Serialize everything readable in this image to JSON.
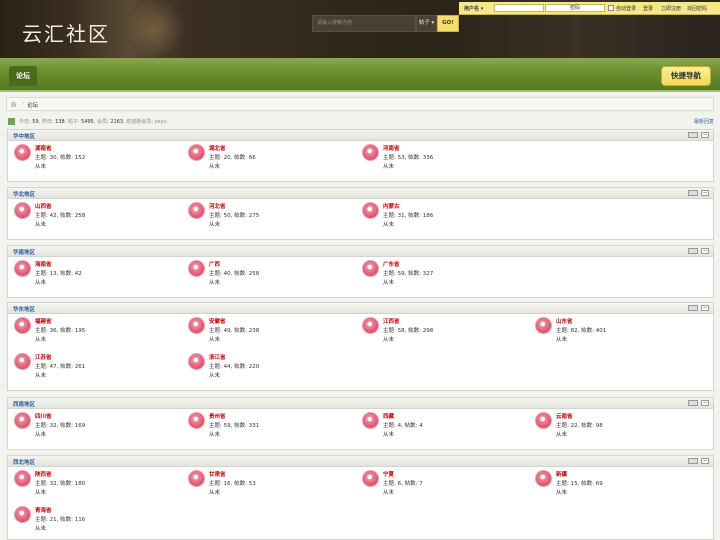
{
  "header": {
    "logo": "云汇社区",
    "search_placeholder": "请输入搜索内容",
    "search_type": "帖子",
    "search_button": "GO!",
    "login": {
      "username_label": "用户名",
      "password_placeholder": "密码",
      "remember": "自动登录",
      "login": "登录",
      "register": "立即注册",
      "forgot": "找回密码"
    }
  },
  "nav": {
    "tab": "论坛",
    "quick_nav": "快捷导航"
  },
  "breadcrumb": {
    "current": "论坛"
  },
  "stats": {
    "today_label": "今日:",
    "today": "59",
    "yesterday_label": "昨日:",
    "yesterday": "138",
    "posts_label": "帖子:",
    "posts": "5495",
    "members_label": "会员:",
    "members": "2163",
    "welcome": "欢迎新会员: yeyu",
    "latest": "最新回复"
  },
  "categories": [
    {
      "title": "华中地区",
      "forums": [
        {
          "name": "湖南省",
          "stat": "主题: 30, 帖数: 152",
          "last": "从未"
        },
        {
          "name": "湖北省",
          "stat": "主题: 20, 帖数: 66",
          "last": "从未"
        },
        {
          "name": "河南省",
          "stat": "主题: 53, 帖数: 336",
          "last": "从未"
        }
      ]
    },
    {
      "title": "华北地区",
      "forums": [
        {
          "name": "山西省",
          "stat": "主题: 42, 帖数: 258",
          "last": "从未"
        },
        {
          "name": "河北省",
          "stat": "主题: 50, 帖数: 275",
          "last": "从未"
        },
        {
          "name": "内蒙古",
          "stat": "主题: 31, 帖数: 186",
          "last": "从未"
        }
      ]
    },
    {
      "title": "华南地区",
      "forums": [
        {
          "name": "海南省",
          "stat": "主题: 13, 帖数: 42",
          "last": "从未"
        },
        {
          "name": "广西",
          "stat": "主题: 40, 帖数: 258",
          "last": "从未"
        },
        {
          "name": "广东省",
          "stat": "主题: 59, 帖数: 327",
          "last": "从未"
        }
      ]
    },
    {
      "title": "华东地区",
      "forums": [
        {
          "name": "福建省",
          "stat": "主题: 36, 帖数: 195",
          "last": "从未"
        },
        {
          "name": "安徽省",
          "stat": "主题: 49, 帖数: 238",
          "last": "从未"
        },
        {
          "name": "江西省",
          "stat": "主题: 58, 帖数: 298",
          "last": "从未"
        },
        {
          "name": "山东省",
          "stat": "主题: 82, 帖数: 401",
          "last": "从未"
        },
        {
          "name": "江苏省",
          "stat": "主题: 47, 帖数: 261",
          "last": "从未"
        },
        {
          "name": "浙江省",
          "stat": "主题: 44, 帖数: 220",
          "last": "从未"
        }
      ]
    },
    {
      "title": "西南地区",
      "forums": [
        {
          "name": "四川省",
          "stat": "主题: 32, 帖数: 169",
          "last": "从未"
        },
        {
          "name": "贵州省",
          "stat": "主题: 59, 帖数: 331",
          "last": "从未"
        },
        {
          "name": "西藏",
          "stat": "主题: 4, 帖数: 4",
          "last": "从未"
        },
        {
          "name": "云南省",
          "stat": "主题: 22, 帖数: 98",
          "last": "从未"
        }
      ]
    },
    {
      "title": "西北地区",
      "forums": [
        {
          "name": "陕西省",
          "stat": "主题: 32, 帖数: 180",
          "last": "从未"
        },
        {
          "name": "甘肃省",
          "stat": "主题: 16, 帖数: 53",
          "last": "从未"
        },
        {
          "name": "宁夏",
          "stat": "主题: 6, 帖数: 7",
          "last": "从未"
        },
        {
          "name": "新疆",
          "stat": "主题: 15, 帖数: 69",
          "last": "从未"
        },
        {
          "name": "青海省",
          "stat": "主题: 21, 帖数: 116",
          "last": "从未"
        }
      ]
    }
  ]
}
